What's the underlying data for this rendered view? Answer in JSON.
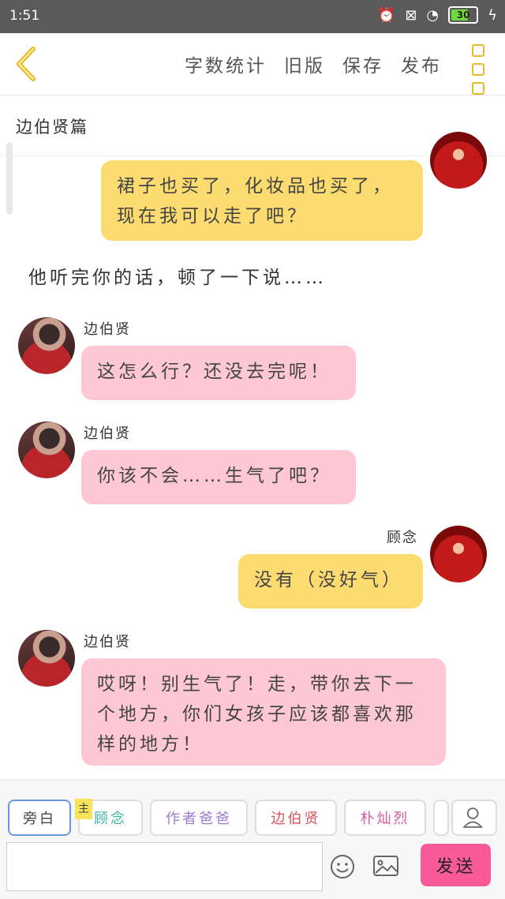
{
  "status": {
    "time": "1:51",
    "battery": "30"
  },
  "topbar": {
    "nav": [
      "字数统计",
      "旧版",
      "保存",
      "发布"
    ]
  },
  "story_title": "边伯贤篇",
  "messages": [
    {
      "text_line1": "裙子也买了，化妆品也买了，",
      "text_line2": "现在我可以走了吧？"
    },
    {
      "narration": "他听完你的话，顿了一下说……"
    },
    {
      "name": "边伯贤",
      "text": "这怎么行？还没去完呢！"
    },
    {
      "name": "边伯贤",
      "text": "你该不会……生气了吧？"
    },
    {
      "name": "顾念",
      "text": "没有（没好气）"
    },
    {
      "name": "边伯贤",
      "text_line1": "哎呀！别生气了！走，带你去下一",
      "text_line2": "个地方，你们女孩子应该都喜欢那",
      "text_line3": "样的地方！"
    }
  ],
  "characters": {
    "narrator": "旁白",
    "main_badge": "主",
    "guinian": "顾念",
    "author": "作者爸爸",
    "byun": "边伯贤",
    "park": "朴灿烈"
  },
  "composer": {
    "send_label": "发送"
  },
  "colors": {
    "accent_yellow": "#fcdc71",
    "accent_pink": "#fdc8d3",
    "send": "#fb5a98"
  }
}
